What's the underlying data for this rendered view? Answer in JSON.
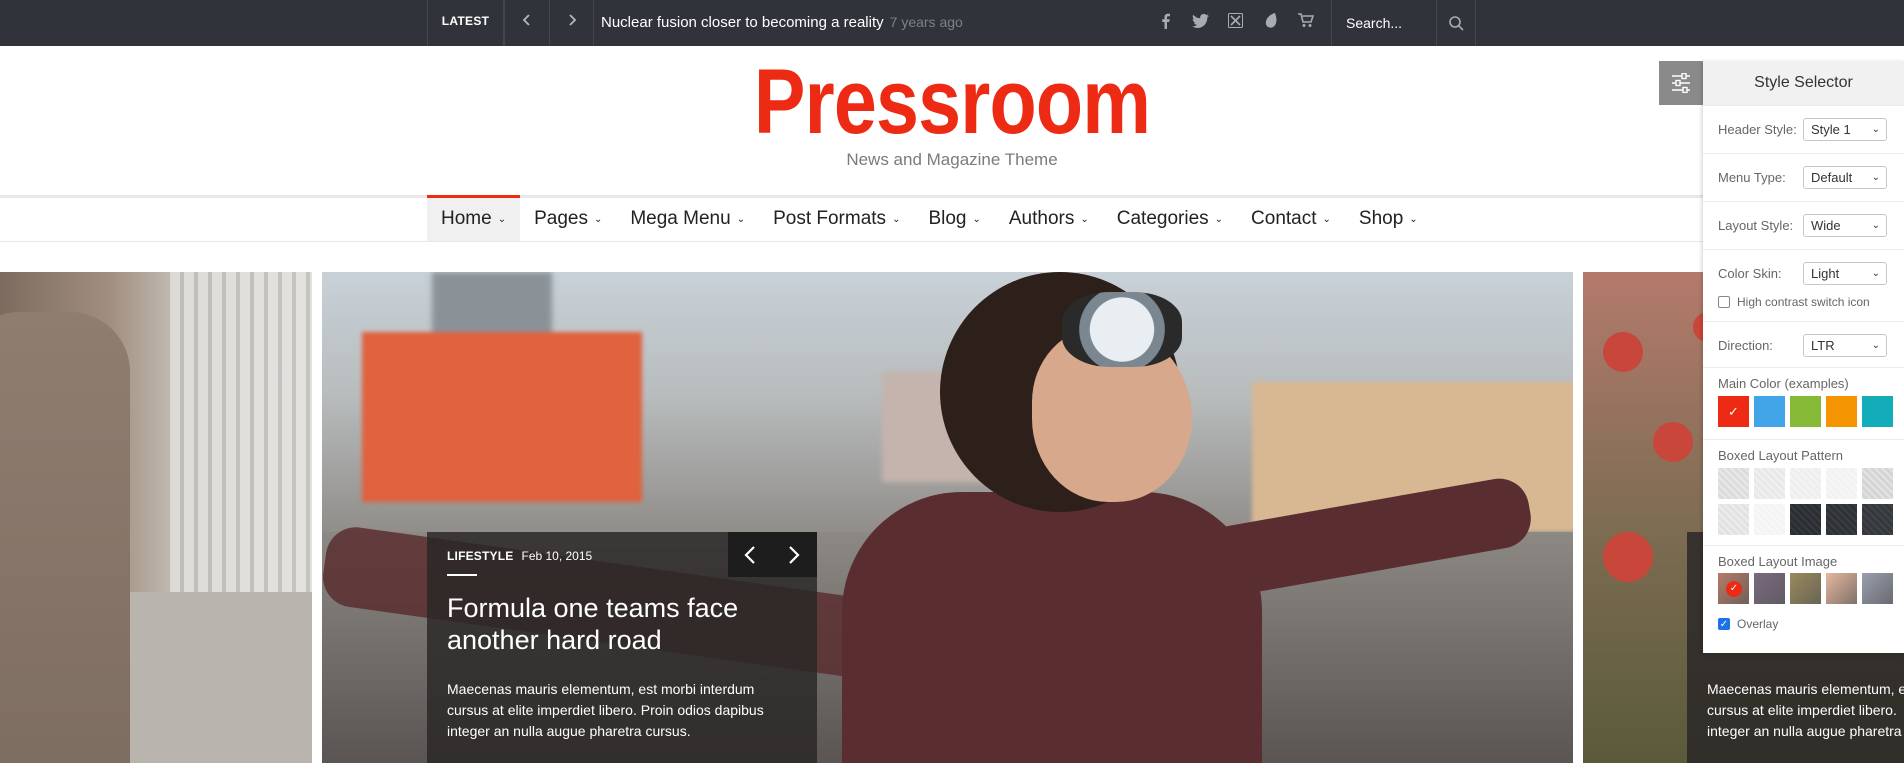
{
  "topbar": {
    "latest_label": "LATEST",
    "prev_icon": "chevron-left-icon",
    "next_icon": "chevron-right-icon",
    "headline": "Nuclear fusion closer to becoming a reality",
    "time_ago": "7 years ago",
    "social_icons": [
      "facebook-icon",
      "twitter-icon",
      "xing-icon",
      "envato-icon",
      "cart-icon"
    ],
    "search_placeholder": "Search..."
  },
  "header": {
    "logo": "Pressroom",
    "tagline": "News and Magazine Theme",
    "brand_color": "#ED2B14"
  },
  "menu": {
    "items": [
      {
        "label": "Home",
        "active": true
      },
      {
        "label": "Pages"
      },
      {
        "label": "Mega Menu"
      },
      {
        "label": "Post Formats"
      },
      {
        "label": "Blog"
      },
      {
        "label": "Authors"
      },
      {
        "label": "Categories"
      },
      {
        "label": "Contact"
      },
      {
        "label": "Shop"
      }
    ]
  },
  "slider": {
    "main": {
      "category": "LIFESTYLE",
      "date": "Feb 10, 2015",
      "title": "Formula one teams face another hard road",
      "excerpt": "Maecenas mauris elementum, est morbi interdum cursus at elite imperdiet libero. Proin odios dapibus integer an nulla augue pharetra cursus."
    },
    "right": {
      "excerpt_line1": "Maecenas mauris elementum, e",
      "excerpt_line2": "cursus at elite imperdiet libero.",
      "excerpt_line3": "integer an nulla augue pharetra"
    }
  },
  "style_selector": {
    "title": "Style Selector",
    "toggle_icon": "sliders-icon",
    "header_style": {
      "label": "Header Style:",
      "value": "Style 1"
    },
    "menu_type": {
      "label": "Menu Type:",
      "value": "Default"
    },
    "layout_style": {
      "label": "Layout Style:",
      "value": "Wide"
    },
    "color_skin": {
      "label": "Color Skin:",
      "value": "Light"
    },
    "high_contrast": {
      "label": "High contrast switch icon",
      "checked": false
    },
    "direction": {
      "label": "Direction:",
      "value": "LTR"
    },
    "main_color": {
      "label": "Main Color (examples)",
      "colors": [
        "#ED2B14",
        "#42A5E8",
        "#85B936",
        "#F39400",
        "#13ADBA"
      ],
      "selected_index": 0
    },
    "boxed_pattern": {
      "label": "Boxed Layout Pattern",
      "colors": [
        "#DCDCDC",
        "#E8E8E8",
        "#EEEEEE",
        "#F2F2F2",
        "#D4D4D4",
        "#E2E2E2",
        "#F4F4F4",
        "#2A2D31",
        "#2E3136",
        "#34383D"
      ]
    },
    "boxed_image": {
      "label": "Boxed Layout Image",
      "colors": [
        "#B47B68",
        "#7A6A80",
        "#9A8A5A",
        "#E7B79E",
        "#9A9FB1"
      ],
      "selected_index": 0
    },
    "overlay": {
      "label": "Overlay",
      "checked": true
    }
  }
}
